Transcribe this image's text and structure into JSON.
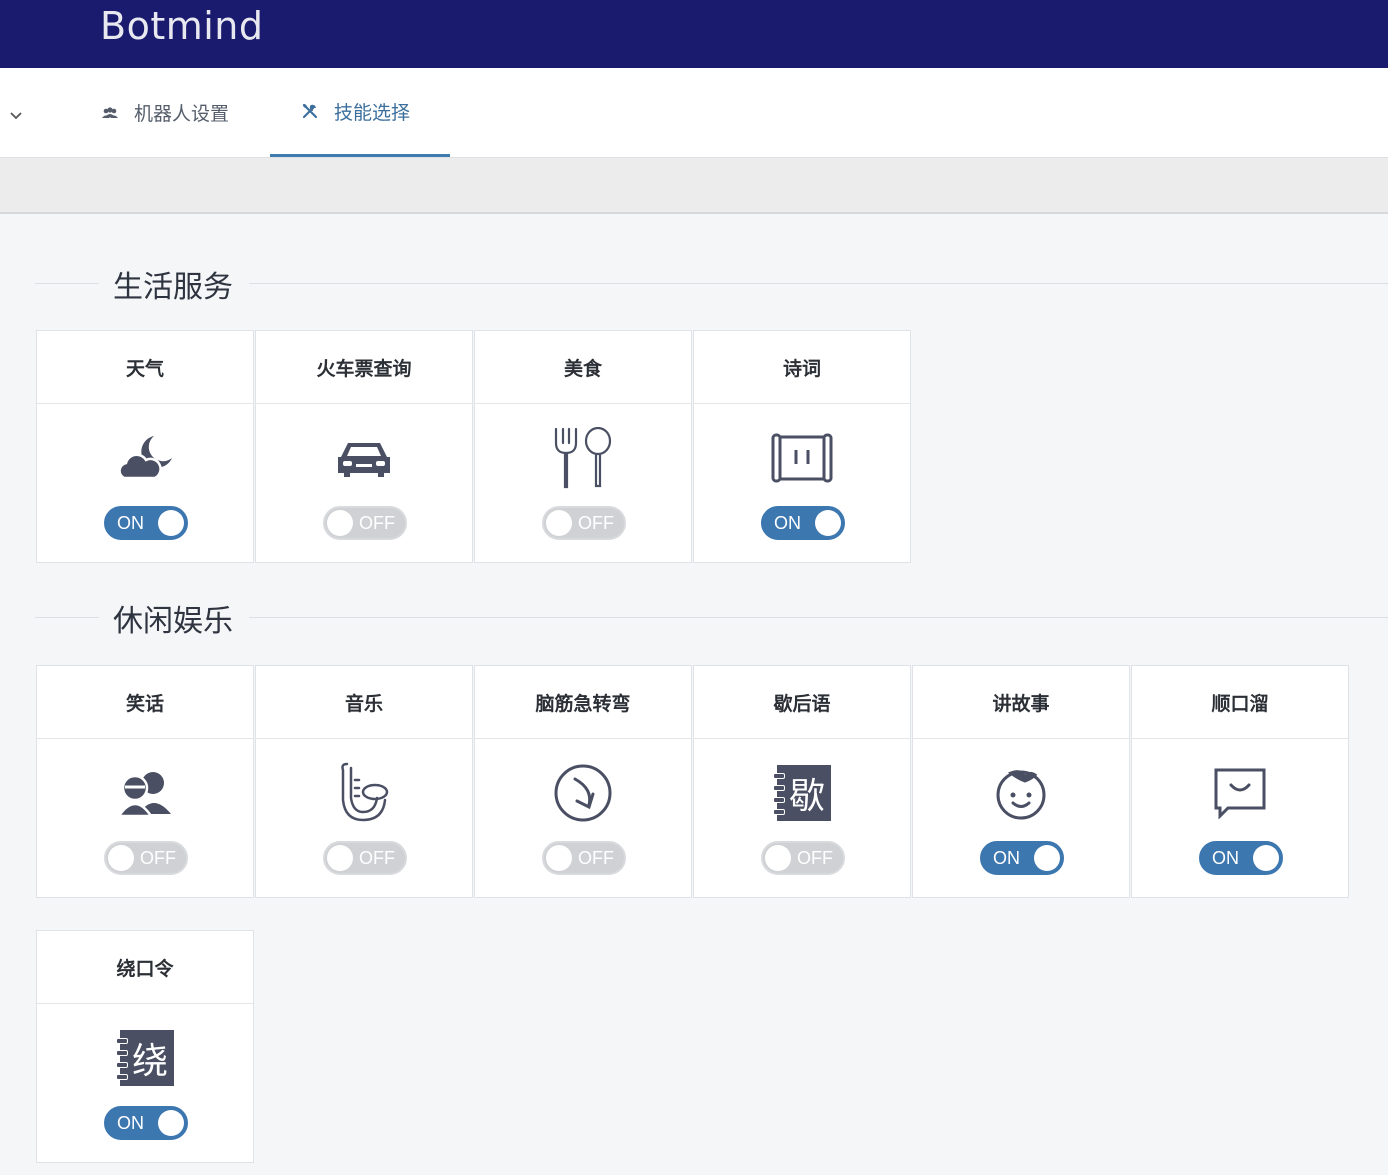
{
  "app": {
    "brand": "Botmind"
  },
  "tabs": [
    {
      "label": "机器人设置",
      "icon": "users-icon",
      "active": false
    },
    {
      "label": "技能选择",
      "icon": "tools-icon",
      "active": true
    }
  ],
  "colors": {
    "topbar": "#1a1a6e",
    "accent": "#3c77b0",
    "icon": "#4a4f63",
    "off": "#cfd1d4"
  },
  "sections": [
    {
      "title": "生活服务",
      "skills": [
        {
          "name": "天气",
          "icon": "cloud-moon-icon",
          "toggle": "ON"
        },
        {
          "name": "火车票查询",
          "icon": "car-icon",
          "toggle": "OFF"
        },
        {
          "name": "美食",
          "icon": "fork-spoon-icon",
          "toggle": "OFF"
        },
        {
          "name": "诗词",
          "icon": "scroll-icon",
          "toggle": "ON"
        }
      ]
    },
    {
      "title": "休闲娱乐",
      "skills": [
        {
          "name": "笑话",
          "icon": "people-icon",
          "toggle": "OFF"
        },
        {
          "name": "音乐",
          "icon": "saxophone-icon",
          "toggle": "OFF"
        },
        {
          "name": "脑筋急转弯",
          "icon": "turn-arrow-icon",
          "toggle": "OFF"
        },
        {
          "name": "歇后语",
          "icon": "notebook-icon",
          "glyph": "歇",
          "toggle": "OFF"
        },
        {
          "name": "讲故事",
          "icon": "boy-face-icon",
          "toggle": "ON"
        },
        {
          "name": "顺口溜",
          "icon": "chat-smile-icon",
          "toggle": "ON"
        },
        {
          "name": "绕口令",
          "icon": "notebook-icon",
          "glyph": "绕",
          "toggle": "ON"
        }
      ]
    }
  ]
}
